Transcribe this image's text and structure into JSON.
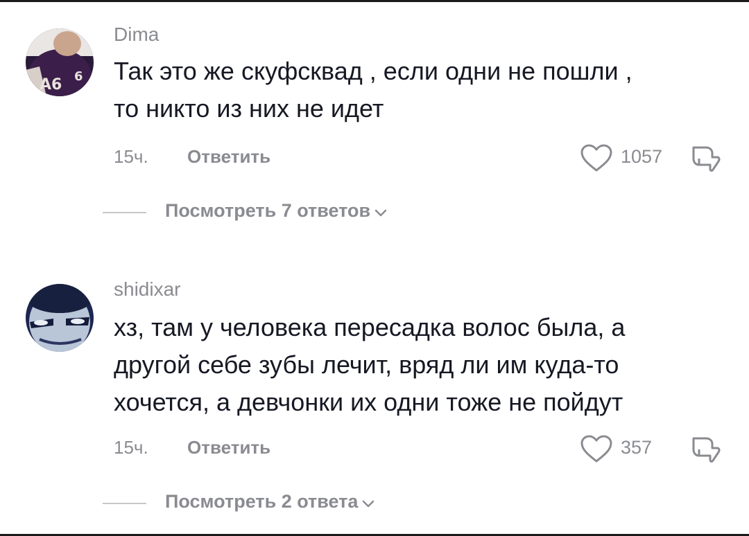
{
  "comments": [
    {
      "username": "Dima",
      "text_lines": [
        "Так это же скуфсквад , если одни не пошли ,",
        "то никто из них не идет"
      ],
      "time": "15ч.",
      "reply_label": "Ответить",
      "likes": "1057",
      "view_replies": "Посмотреть 7 ответов",
      "avatar_icon": "user-avatar-dark"
    },
    {
      "username": "shidixar",
      "text_lines": [
        "хз, там у человека пересадка волос была, а",
        "другой себе зубы лечит, вряд ли им куда-то",
        "хочется, а девчонки их одни тоже не пойдут"
      ],
      "time": "15ч.",
      "reply_label": "Ответить",
      "likes": "357",
      "view_replies": "Посмотреть 2 ответа",
      "avatar_icon": "user-avatar-face"
    }
  ],
  "icons": {
    "like": "heart-outline-icon",
    "dislike": "thumbs-down-outline-icon",
    "expand": "chevron-down-icon"
  },
  "colors": {
    "text": "#161823",
    "secondary": "#8a8b91",
    "divider": "#c6c7ca"
  }
}
